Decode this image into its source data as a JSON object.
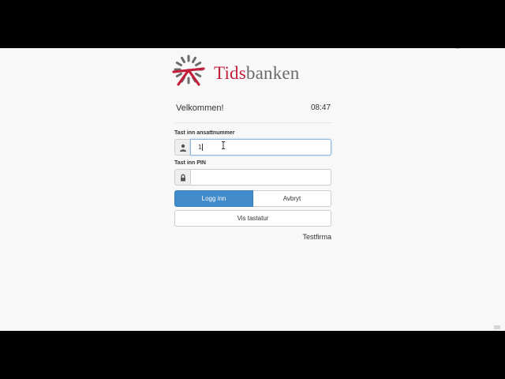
{
  "brand": {
    "accent_text": "Tids",
    "rest_text": "banken",
    "accent_color": "#c21f3a",
    "rest_color": "#6b6b6b",
    "logo_icon": "clock-burst-logo-icon"
  },
  "header": {
    "welcome": "Velkommen!",
    "time": "08:47"
  },
  "form": {
    "employee_label": "Tast inn ansattnummer",
    "employee_value": "1",
    "employee_icon": "user-icon",
    "pin_label": "Tast inn PIN",
    "pin_value": "",
    "pin_icon": "lock-icon"
  },
  "buttons": {
    "login": "Logg inn",
    "cancel": "Avbryt",
    "show_keyboard": "Vis tastatur",
    "primary_color": "#428bca"
  },
  "footer": {
    "company": "Testfirma"
  }
}
